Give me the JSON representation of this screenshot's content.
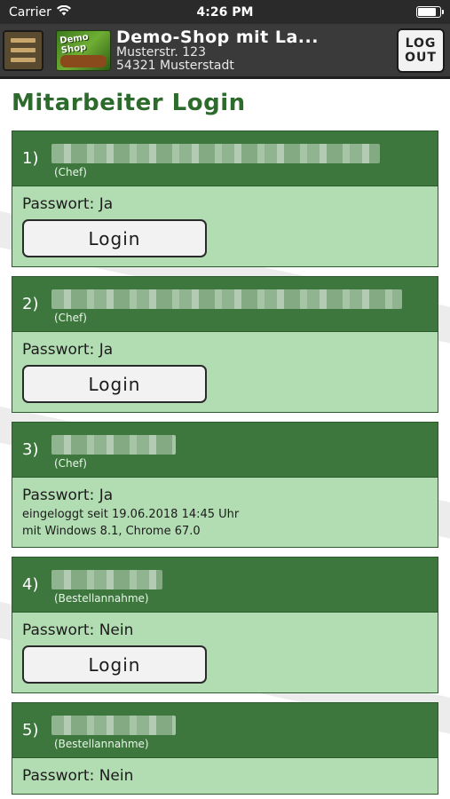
{
  "status_bar": {
    "carrier": "Carrier",
    "time": "4:26 PM",
    "battery_level": 0.85
  },
  "header": {
    "logo_text": "Demo Shop",
    "shop_name": "Demo-Shop mit La...",
    "street": "Musterstr. 123",
    "city": "54321 Musterstadt",
    "logout_line1": "LOG",
    "logout_line2": "OUT"
  },
  "page_title": "Mitarbeiter Login",
  "employees": [
    {
      "num": "1)",
      "role": "(Chef)",
      "password": "Passwort: Ja",
      "login_label": "Login"
    },
    {
      "num": "2)",
      "role": "(Chef)",
      "password": "Passwort: Ja",
      "login_label": "Login"
    },
    {
      "num": "3)",
      "role": "(Chef)",
      "password": "Passwort: Ja",
      "logged_in": "eingeloggt seit 19.06.2018 14:45 Uhr",
      "device": "mit Windows 8.1, Chrome 67.0"
    },
    {
      "num": "4)",
      "role": "(Bestellannahme)",
      "password": "Passwort: Nein",
      "login_label": "Login"
    },
    {
      "num": "5)",
      "role": "(Bestellannahme)",
      "password": "Passwort: Nein"
    }
  ],
  "colors": {
    "accent": "#3e773e",
    "card_bg": "#b2ddb2",
    "title": "#2d6b2d"
  },
  "icons": {
    "wifi": "wifi-icon",
    "battery": "battery-icon",
    "menu": "hamburger-menu-icon"
  }
}
